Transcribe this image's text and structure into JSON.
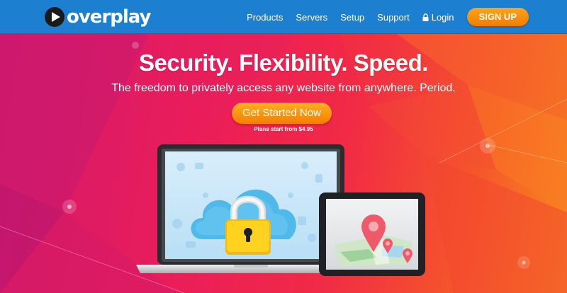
{
  "brand": {
    "name": "overplay"
  },
  "nav": {
    "items": [
      "Products",
      "Servers",
      "Setup",
      "Support"
    ],
    "login_label": "Login",
    "signup_label": "SIGN UP"
  },
  "hero": {
    "headline": "Security. Flexibility. Speed.",
    "subheadline": "The freedom to privately access any website from anywhere. Period.",
    "cta_label": "Get Started Now",
    "plans_note": "Plans start from $4.95"
  },
  "icons": [
    "play-logo-icon",
    "lock-icon",
    "cloud-padlock-icon",
    "map-pin-icon"
  ],
  "colors": {
    "navbar": "#1d7fd0",
    "button_orange": "#f68a0a",
    "hero_magenta": "#d0186e",
    "hero_orange": "#f88a1e",
    "cloud_blue": "#4fb9ea",
    "padlock_yellow": "#ffd21f",
    "pin_red": "#ef5a6b"
  }
}
